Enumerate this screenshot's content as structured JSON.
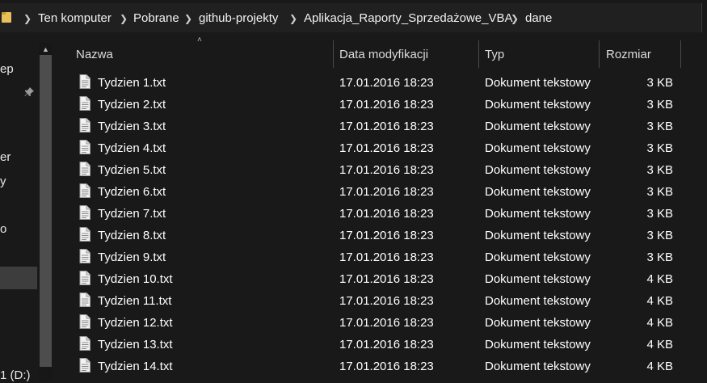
{
  "breadcrumb": {
    "items": [
      "Ten komputer",
      "Pobrane",
      "github-projekty",
      "Aplikacja_Raporty_Sprzedażowe_VBA",
      "dane"
    ],
    "separator": ">"
  },
  "nav": {
    "items": [
      "ep",
      "er",
      "y",
      "o",
      "1 (D:)"
    ]
  },
  "columns": {
    "name": "Nazwa",
    "date": "Data modyfikacji",
    "type": "Typ",
    "size": "Rozmiar"
  },
  "files": [
    {
      "name": "Tydzien 1.txt",
      "date": "17.01.2016 18:23",
      "type": "Dokument tekstowy",
      "size": "3 KB"
    },
    {
      "name": "Tydzien 2.txt",
      "date": "17.01.2016 18:23",
      "type": "Dokument tekstowy",
      "size": "3 KB"
    },
    {
      "name": "Tydzien 3.txt",
      "date": "17.01.2016 18:23",
      "type": "Dokument tekstowy",
      "size": "3 KB"
    },
    {
      "name": "Tydzien 4.txt",
      "date": "17.01.2016 18:23",
      "type": "Dokument tekstowy",
      "size": "3 KB"
    },
    {
      "name": "Tydzien 5.txt",
      "date": "17.01.2016 18:23",
      "type": "Dokument tekstowy",
      "size": "3 KB"
    },
    {
      "name": "Tydzien 6.txt",
      "date": "17.01.2016 18:23",
      "type": "Dokument tekstowy",
      "size": "3 KB"
    },
    {
      "name": "Tydzien 7.txt",
      "date": "17.01.2016 18:23",
      "type": "Dokument tekstowy",
      "size": "3 KB"
    },
    {
      "name": "Tydzien 8.txt",
      "date": "17.01.2016 18:23",
      "type": "Dokument tekstowy",
      "size": "3 KB"
    },
    {
      "name": "Tydzien 9.txt",
      "date": "17.01.2016 18:23",
      "type": "Dokument tekstowy",
      "size": "3 KB"
    },
    {
      "name": "Tydzien 10.txt",
      "date": "17.01.2016 18:23",
      "type": "Dokument tekstowy",
      "size": "4 KB"
    },
    {
      "name": "Tydzien 11.txt",
      "date": "17.01.2016 18:23",
      "type": "Dokument tekstowy",
      "size": "4 KB"
    },
    {
      "name": "Tydzien 12.txt",
      "date": "17.01.2016 18:23",
      "type": "Dokument tekstowy",
      "size": "4 KB"
    },
    {
      "name": "Tydzien 13.txt",
      "date": "17.01.2016 18:23",
      "type": "Dokument tekstowy",
      "size": "4 KB"
    },
    {
      "name": "Tydzien 14.txt",
      "date": "17.01.2016 18:23",
      "type": "Dokument tekstowy",
      "size": "4 KB"
    }
  ],
  "icons": {
    "folder": "folder-icon",
    "file": "text-file-icon",
    "pin": "pin-icon",
    "sort": "sort-ascending-icon",
    "scroll_up": "scroll-up-arrow-icon"
  },
  "colors": {
    "background": "#191919",
    "text": "#ffffff",
    "folder": "#e8c15a",
    "selection": "#3d3d3d"
  }
}
